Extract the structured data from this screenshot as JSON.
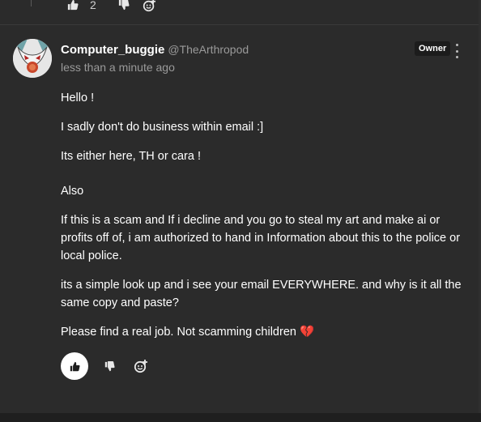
{
  "previous_comment": {
    "like_count": "2"
  },
  "comment": {
    "username": "Computer_buggie",
    "handle": "@TheArthropod",
    "timestamp": "less than a minute ago",
    "badge": "Owner",
    "paragraphs": [
      "Hello !",
      "I sadly don't do business within email :]",
      "Its either here, TH or cara !",
      "Also",
      "If this is a scam and If i decline and you go to steal my art and make ai or profits off of, i am authorized to hand in Information about this to the police or local police.",
      "its a simple look up and i see your email EVERYWHERE. and why is it all the same copy and paste?",
      "Please find a real job. Not scamming children 💔"
    ]
  },
  "icons": {
    "like": "thumbs-up-icon",
    "dislike": "thumbs-down-icon",
    "react": "add-reaction-icon",
    "more": "more-vertical-icon"
  },
  "colors": {
    "background": "#2b2b2b",
    "text": "#ffffff",
    "muted": "#9a9a9a",
    "badge_bg": "#1c1c1c"
  }
}
